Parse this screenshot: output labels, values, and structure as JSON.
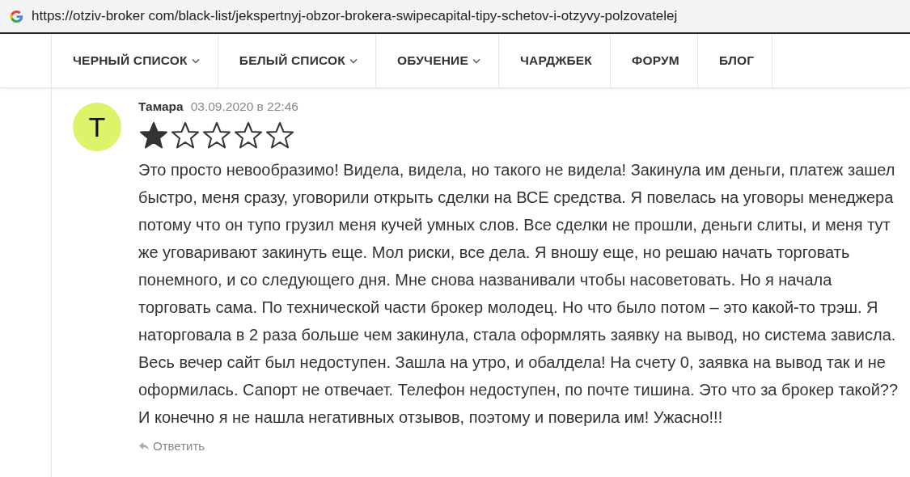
{
  "address_bar": {
    "url": "https://otziv-broker com/black-list/jekspertnyj-obzor-brokera-swipecapital-tipy-schetov-i-otzyvy-polzovatelej"
  },
  "nav": {
    "items": [
      {
        "label": "ЧЕРНЫЙ СПИСОК",
        "has_menu": true
      },
      {
        "label": "БЕЛЫЙ СПИСОК",
        "has_menu": true
      },
      {
        "label": "ОБУЧЕНИЕ",
        "has_menu": true
      },
      {
        "label": "ЧАРДЖБЕК",
        "has_menu": false
      },
      {
        "label": "ФОРУМ",
        "has_menu": false
      },
      {
        "label": "БЛОГ",
        "has_menu": false
      }
    ]
  },
  "comment": {
    "avatar_letter": "T",
    "author": "Тамара",
    "date": "03.09.2020 в 22:46",
    "stars": 1,
    "text": "Это просто невообразимо! Видела, видела, но такого не видела! Закинула им деньги, платеж зашел быстро, меня сразу, уговорили открыть сделки на ВСЕ средства. Я повелась на уговоры менеджера потому что он тупо грузил меня кучей умных слов. Все сделки не прошли, деньги слиты, и меня тут же уговаривают закинуть еще. Мол риски, все дела. Я вношу еще, но решаю начать торговать понемного, и со следующего дня. Мне снова названивали чтобы насоветовать. Но я начала торговать сама. По технической части брокер молодец. Но что было потом – это какой-то трэш. Я наторговала в 2 раза больше чем закинула, стала оформлять заявку на вывод, но система зависла. Весь вечер сайт был недоступен. Зашла на утро, и обалдела! На счету 0, заявка на вывод так и не оформилась. Сапорт не отвечает. Телефон недоступен, по почте тишина. Это что за брокер такой?? И конечно я не нашла негативных отзывов, поэтому и поверила им! Ужасно!!!",
    "reply_label": "Ответить"
  }
}
